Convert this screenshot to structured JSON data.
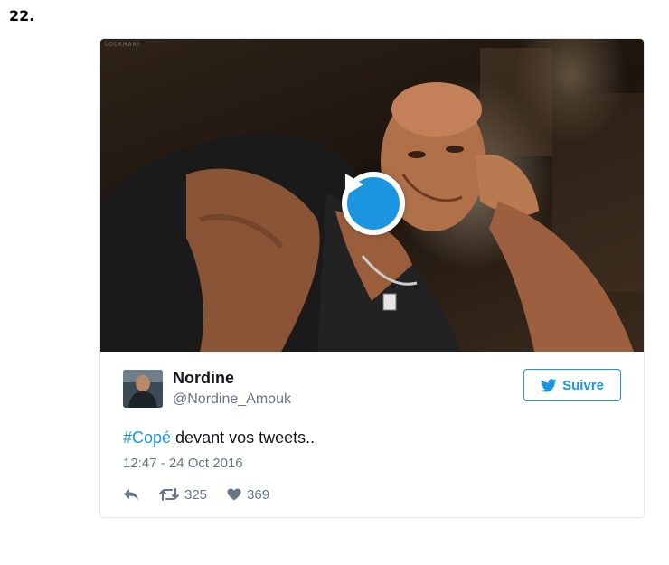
{
  "item_number": "22.",
  "media": {
    "watermark": "LOCKHART",
    "play_icon": "play-icon"
  },
  "tweet": {
    "user_name": "Nordine",
    "user_handle": "@Nordine_Amouk",
    "follow_label": "Suivre",
    "hashtag": "#Copé",
    "text": " devant vos tweets..",
    "timestamp": "12:47 - 24 Oct 2016",
    "retweets": "325",
    "likes": "369"
  },
  "colors": {
    "accent": "#1b95e0",
    "secondary_text": "#657786",
    "border": "#e1e8ed"
  },
  "icons": [
    "play-icon",
    "twitter-bird-icon",
    "reply-icon",
    "retweet-icon",
    "heart-icon"
  ]
}
